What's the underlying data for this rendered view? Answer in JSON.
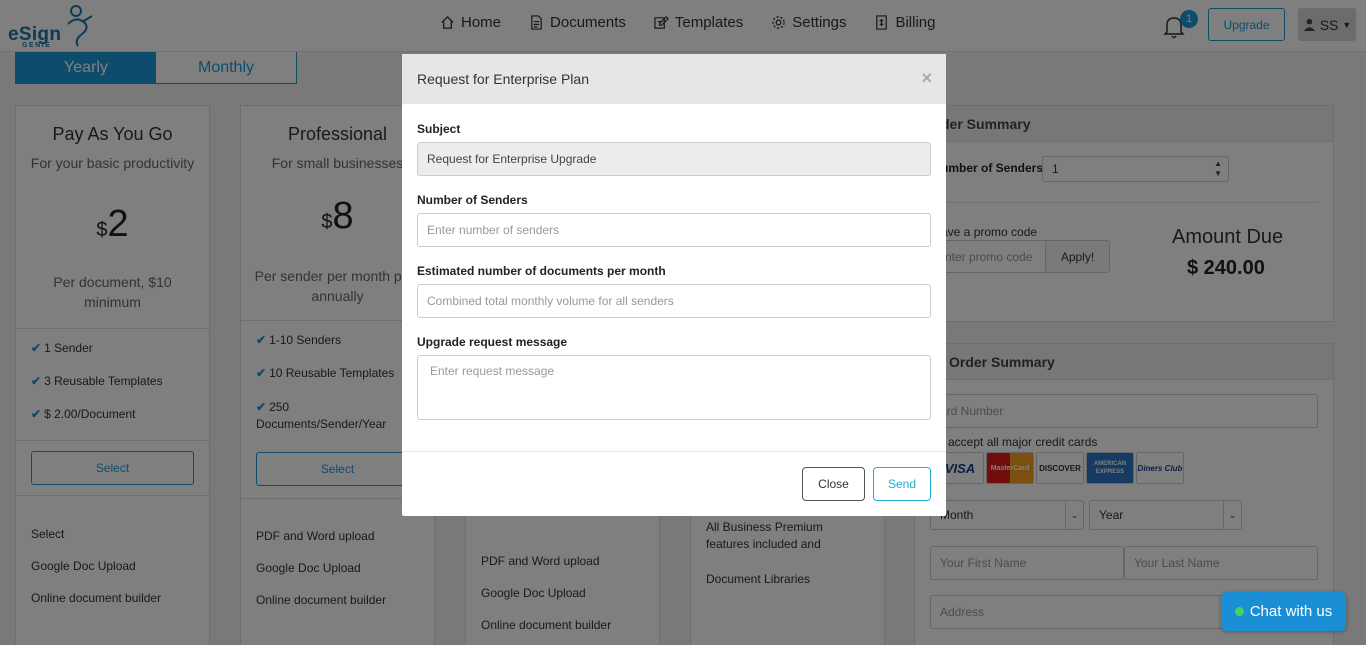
{
  "app": {
    "logo_word": "eSign",
    "logo_sub": "GENIE"
  },
  "nav": {
    "items": [
      {
        "label": "Home",
        "icon": "home-icon"
      },
      {
        "label": "Documents",
        "icon": "document-icon"
      },
      {
        "label": "Templates",
        "icon": "template-icon"
      },
      {
        "label": "Settings",
        "icon": "gear-icon"
      },
      {
        "label": "Billing",
        "icon": "billing-icon"
      }
    ],
    "notification_count": "1",
    "upgrade_label": "Upgrade",
    "user_initials": "SS"
  },
  "billing_toggle": {
    "yearly": "Yearly",
    "monthly": "Monthly"
  },
  "plans": [
    {
      "name": "Pay As You Go",
      "desc": "For your basic productivity",
      "currency": "$",
      "price": "2",
      "per": "Per document, $10 minimum",
      "features": [
        "1 Sender",
        "3 Reusable Templates",
        "$ 2.00/Document"
      ],
      "select_label": "Select",
      "more": [
        "Select",
        "Google Doc Upload",
        "Online document builder"
      ]
    },
    {
      "name": "Professional",
      "desc": "For small businesses",
      "currency": "$",
      "price": "8",
      "per": "Per sender per month paid annually",
      "features": [
        "1-10 Senders",
        "10 Reusable Templates",
        "250 Documents/Sender/Year"
      ],
      "select_label": "Select",
      "more": [
        "PDF and Word upload",
        "Google Doc Upload",
        "Online document builder"
      ]
    },
    {
      "more": [
        "PDF and Word upload",
        "Google Doc Upload",
        "Online document builder"
      ]
    },
    {
      "more": [
        "All Business Premium features included and",
        "Document Libraries"
      ]
    }
  ],
  "order_summary": {
    "title": "der Summary",
    "senders_label": "umber of Senders:",
    "senders_value": "1",
    "promo_label": "ave a promo code",
    "promo_placeholder": "nter promo code",
    "apply_label": "Apply!",
    "amount_due_label": "Amount Due",
    "amount_due_value": "$ 240.00"
  },
  "payment": {
    "title": "Order Summary",
    "card_number_placeholder": "ard Number",
    "cards_note": "accept all major credit cards",
    "cards": [
      "VISA",
      "MasterCard",
      "DISCOVER",
      "AMERICAN EXPRESS",
      "Diners Club"
    ],
    "month_label": "Month",
    "year_label": "Year",
    "first_name_placeholder": "Your First Name",
    "last_name_placeholder": "Your Last Name",
    "address_placeholder": "Address"
  },
  "modal": {
    "title": "Request for Enterprise Plan",
    "close_x": "×",
    "subject_label": "Subject",
    "subject_value": "Request for Enterprise Upgrade",
    "senders_label": "Number of Senders",
    "senders_placeholder": "Enter number of senders",
    "docs_label": "Estimated number of documents per month",
    "docs_placeholder": "Combined total monthly volume for all senders",
    "message_label": "Upgrade request message",
    "message_placeholder": "Enter request message",
    "close_button": "Close",
    "send_button": "Send"
  },
  "chat": {
    "label": "Chat with us"
  }
}
